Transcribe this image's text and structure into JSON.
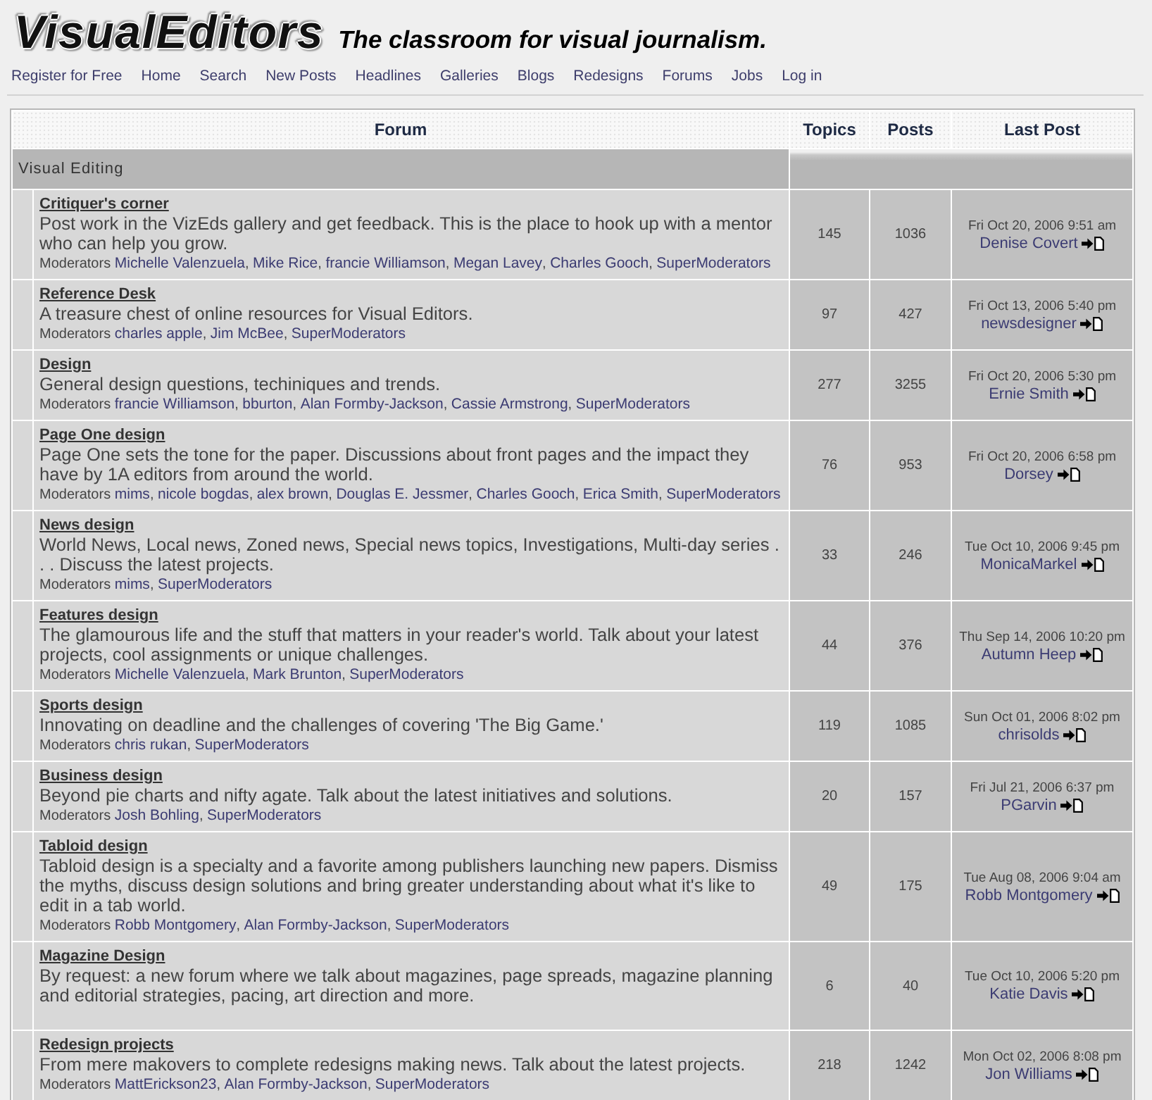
{
  "logo": {
    "wordmark": "VisualEditors",
    "tagline": "The classroom for visual journalism."
  },
  "nav": [
    "Register for Free",
    "Home",
    "Search",
    "New Posts",
    "Headlines",
    "Galleries",
    "Blogs",
    "Redesigns",
    "Forums",
    "Jobs",
    "Log in"
  ],
  "table": {
    "columns": [
      "Forum",
      "Topics",
      "Posts",
      "Last Post"
    ],
    "category": "Visual Editing",
    "rows": [
      {
        "title": "Critiquer's corner",
        "description": "Post work in the VizEds gallery and get feedback. This is the place to hook up with a mentor who can help you grow.",
        "moderators": {
          "label": "Moderators",
          "separator": ",",
          "names": [
            "Michelle Valenzuela",
            "Mike Rice",
            "francie Williamson",
            "Megan Lavey",
            "Charles Gooch",
            "SuperModerators"
          ]
        },
        "topics": "145",
        "posts": "1036",
        "last_post": {
          "date": "Fri Oct 20, 2006 9:51 am",
          "author": "Denise Covert"
        }
      },
      {
        "title": "Reference Desk",
        "description": "A treasure chest of online resources for Visual Editors.",
        "moderators": {
          "label": "Moderators",
          "separator": ",",
          "names": [
            "charles apple",
            "Jim McBee",
            "SuperModerators"
          ]
        },
        "topics": "97",
        "posts": "427",
        "last_post": {
          "date": "Fri Oct 13, 2006 5:40 pm",
          "author": "newsdesigner"
        }
      },
      {
        "title": "Design",
        "description": "General design questions, techiniques and trends.",
        "moderators": {
          "label": "Moderators",
          "separator": ",",
          "names": [
            "francie Williamson",
            "bburton",
            "Alan Formby-Jackson",
            "Cassie Armstrong",
            "SuperModerators"
          ]
        },
        "topics": "277",
        "posts": "3255",
        "last_post": {
          "date": "Fri Oct 20, 2006 5:30 pm",
          "author": "Ernie Smith"
        }
      },
      {
        "title": "Page One design",
        "description": "Page One sets the tone for the paper. Discussions about front pages and the impact they have by 1A editors from around the world.",
        "moderators": {
          "label": "Moderators",
          "separator": ",",
          "names": [
            "mims",
            "nicole bogdas",
            "alex brown",
            "Douglas E. Jessmer",
            "Charles Gooch",
            "Erica Smith",
            "SuperModerators"
          ]
        },
        "topics": "76",
        "posts": "953",
        "last_post": {
          "date": "Fri Oct 20, 2006 6:58 pm",
          "author": "Dorsey"
        }
      },
      {
        "title": "News design",
        "description": "World News, Local news, Zoned news, Special news topics, Investigations, Multi-day series . . . Discuss the latest projects.",
        "moderators": {
          "label": "Moderators",
          "separator": ",",
          "names": [
            "mims",
            "SuperModerators"
          ]
        },
        "topics": "33",
        "posts": "246",
        "last_post": {
          "date": "Tue Oct 10, 2006 9:45 pm",
          "author": "MonicaMarkel"
        }
      },
      {
        "title": "Features design",
        "description": "The glamourous life and the stuff that matters in your reader's world. Talk about your latest projects, cool assignments or unique challenges.",
        "moderators": {
          "label": "Moderators",
          "separator": ",",
          "names": [
            "Michelle Valenzuela",
            "Mark Brunton",
            "SuperModerators"
          ]
        },
        "topics": "44",
        "posts": "376",
        "last_post": {
          "date": "Thu Sep 14, 2006 10:20 pm",
          "author": "Autumn Heep"
        }
      },
      {
        "title": "Sports design",
        "description": "Innovating on deadline and the challenges of covering 'The Big Game.'",
        "moderators": {
          "label": "Moderators",
          "separator": ",",
          "names": [
            "chris rukan",
            "SuperModerators"
          ]
        },
        "topics": "119",
        "posts": "1085",
        "last_post": {
          "date": "Sun Oct 01, 2006 8:02 pm",
          "author": "chrisolds"
        }
      },
      {
        "title": "Business design",
        "description": "Beyond pie charts and nifty agate. Talk about the latest initiatives and solutions.",
        "moderators": {
          "label": "Moderators",
          "separator": ",",
          "names": [
            "Josh Bohling",
            "SuperModerators"
          ]
        },
        "topics": "20",
        "posts": "157",
        "last_post": {
          "date": "Fri Jul 21, 2006 6:37 pm",
          "author": "PGarvin"
        }
      },
      {
        "title": "Tabloid design",
        "description": "Tabloid design is a specialty and a favorite among publishers launching new papers. Dismiss the myths, discuss design solutions and bring greater understanding about what it's like to edit in a tab world.",
        "moderators": {
          "label": "Moderators",
          "separator": ",",
          "names": [
            "Robb Montgomery",
            "Alan Formby-Jackson",
            "SuperModerators"
          ]
        },
        "topics": "49",
        "posts": "175",
        "last_post": {
          "date": "Tue Aug 08, 2006 9:04 am",
          "author": "Robb Montgomery"
        }
      },
      {
        "title": "Magazine Design",
        "description": "By request: a new forum where we talk about magazines, page spreads, magazine planning and editorial strategies, pacing, art direction and more.",
        "topics": "6",
        "posts": "40",
        "last_post": {
          "date": "Tue Oct 10, 2006 5:20 pm",
          "author": "Katie Davis"
        }
      },
      {
        "title": "Redesign projects",
        "description": "From mere makovers to complete redesigns making news. Talk about the latest projects.",
        "moderators": {
          "label": "Moderators",
          "separator": ",",
          "names": [
            "MattErickson23",
            "Alan Formby-Jackson",
            "SuperModerators"
          ]
        },
        "topics": "218",
        "posts": "1242",
        "last_post": {
          "date": "Mon Oct 02, 2006 8:08 pm",
          "author": "Jon Williams"
        }
      }
    ]
  }
}
